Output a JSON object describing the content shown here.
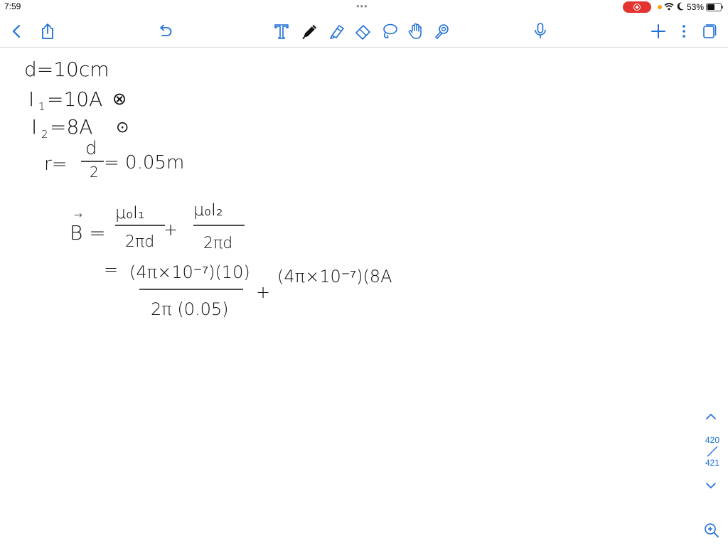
{
  "status_bar": {
    "time": "7:59",
    "battery_percent": "53%",
    "battery_level": 0.53,
    "recording_color": "#e3342f"
  },
  "toolbar": {
    "accent_color": "#1e6fd9",
    "left_icons": [
      "back-icon",
      "share-icon"
    ],
    "undo_icon": "undo-icon",
    "tools": [
      "text-tool-icon",
      "pen-tool-icon",
      "highlighter-tool-icon",
      "eraser-tool-icon",
      "lasso-tool-icon",
      "hand-tool-icon",
      "laser-pointer-icon"
    ],
    "record_icon": "microphone-icon",
    "right_icons": [
      "add-icon",
      "more-icon",
      "pages-icon"
    ]
  },
  "notes": {
    "line1": "d=10cm",
    "line2_lhs": "I",
    "line2_sub": "1",
    "line2_rhs": "=10A",
    "line2_symbol": "⊗",
    "line3_lhs": "I",
    "line3_sub": "2",
    "line3_rhs": "=8A",
    "line3_symbol": "⊙",
    "line4_lhs": "r=",
    "line4_num": "d",
    "line4_den": "2",
    "line4_rhs": "= 0.05m",
    "eq_lhs": "B =",
    "eq_vec": "→",
    "term1_num": "μ₀I₁",
    "term1_den": "2πd",
    "plus1": "+",
    "term2_num": "μ₀I₂",
    "term2_den": "2πd",
    "line6_eq": "=",
    "term3_num": "(4π×10⁻⁷)(10)",
    "term3_den": "2π (0.05)",
    "plus2": "+",
    "term4": "(4π×10⁻⁷)(8A"
  },
  "page_indicator": {
    "current": "420",
    "total": "421"
  }
}
